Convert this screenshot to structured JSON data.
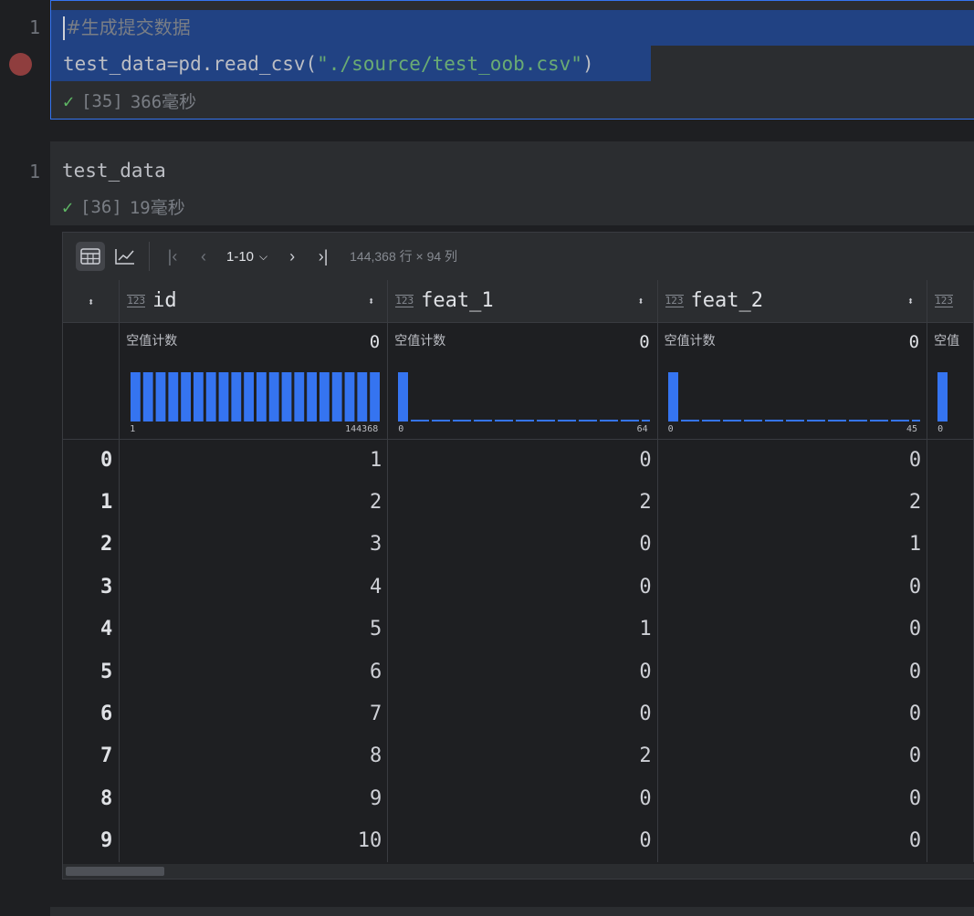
{
  "cells": [
    {
      "line_number": "1",
      "comment_text": "#生成提交数据",
      "code_prefix": "test_data=pd.read_csv(",
      "code_string": "\"./source/test_oob.csv\"",
      "code_suffix": ")",
      "exec_count": "[35]",
      "exec_time": "366毫秒"
    },
    {
      "line_number": "1",
      "code": "test_data",
      "exec_count": "[36]",
      "exec_time": "19毫秒"
    }
  ],
  "toolbar": {
    "table_view_icon": "table-grid-icon",
    "chart_view_icon": "line-chart-icon",
    "first_page_icon": "first-page-icon",
    "prev_page_icon": "prev-page-icon",
    "page_range": "1-10",
    "next_page_icon": "next-page-icon",
    "last_page_icon": "last-page-icon",
    "dimensions": "144,368 行 × 94 列"
  },
  "table": {
    "type_icon": "123",
    "stat_label": "空值计数",
    "columns": [
      {
        "name": "id",
        "null_count": "0",
        "hist_min": "1",
        "hist_max": "144368"
      },
      {
        "name": "feat_1",
        "null_count": "0",
        "hist_min": "0",
        "hist_max": "64"
      },
      {
        "name": "feat_2",
        "null_count": "0",
        "hist_min": "0",
        "hist_max": "45"
      },
      {
        "name": "",
        "null_count": "",
        "hist_min": "0",
        "hist_max": ""
      }
    ],
    "partial_stat_label": "空值",
    "row_indices": [
      "0",
      "1",
      "2",
      "3",
      "4",
      "5",
      "6",
      "7",
      "8",
      "9"
    ],
    "rows": [
      [
        "1",
        "0",
        "0"
      ],
      [
        "2",
        "2",
        "2"
      ],
      [
        "3",
        "0",
        "1"
      ],
      [
        "4",
        "0",
        "0"
      ],
      [
        "5",
        "1",
        "0"
      ],
      [
        "6",
        "0",
        "0"
      ],
      [
        "7",
        "0",
        "0"
      ],
      [
        "8",
        "2",
        "0"
      ],
      [
        "9",
        "0",
        "0"
      ],
      [
        "10",
        "0",
        "0"
      ]
    ]
  },
  "colors": {
    "accent": "#3574f0",
    "selection": "#214283",
    "histogram_bar": "#3574f0",
    "string_literal": "#6aab73",
    "success_check": "#5fb865",
    "breakpoint": "#8f3e3e"
  }
}
